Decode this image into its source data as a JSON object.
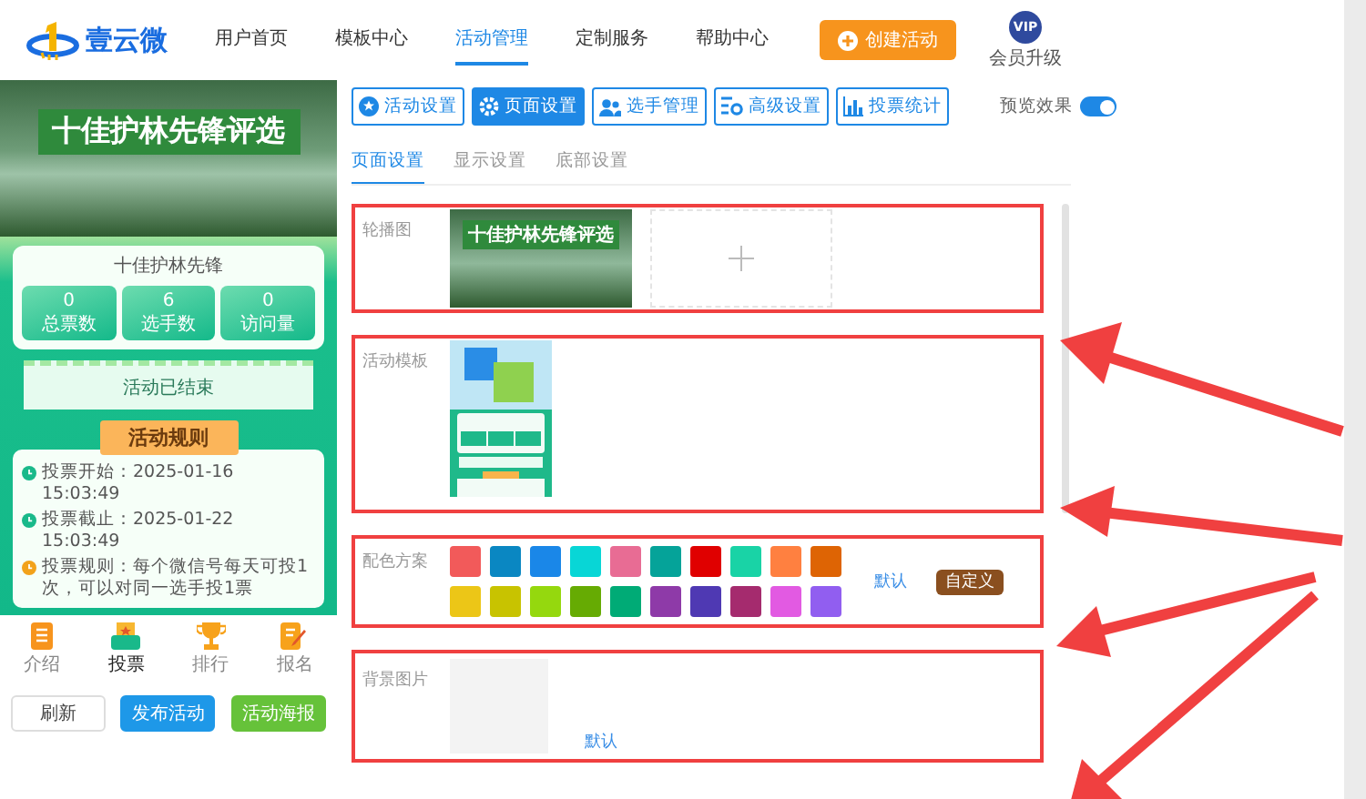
{
  "header": {
    "logo": "壹云微",
    "nav": [
      {
        "label": "用户首页",
        "selected": false
      },
      {
        "label": "模板中心",
        "selected": false
      },
      {
        "label": "活动管理",
        "selected": true
      },
      {
        "label": "定制服务",
        "selected": false
      },
      {
        "label": "帮助中心",
        "selected": false
      }
    ],
    "create_button": "创建活动",
    "vip": {
      "badge": "VIP",
      "label": "会员升级"
    }
  },
  "preview": {
    "banner_title": "十佳护林先锋评选",
    "activity_name": "十佳护林先锋",
    "stats": [
      {
        "value": "0",
        "label": "总票数"
      },
      {
        "value": "6",
        "label": "选手数"
      },
      {
        "value": "0",
        "label": "访问量"
      }
    ],
    "status": "活动已结束",
    "rules_title": "活动规则",
    "rules": [
      {
        "kind": "start",
        "label": "投票开始：",
        "text": "2025-01-16 15:03:49"
      },
      {
        "kind": "end",
        "label": "投票截止：",
        "text": "2025-01-22 15:03:49"
      },
      {
        "kind": "rule",
        "label": "投票规则：",
        "text": "每个微信号每天可投1次，可以对同一选手投1票"
      }
    ],
    "bottom_nav": [
      {
        "label": "介绍",
        "selected": false
      },
      {
        "label": "投票",
        "selected": true
      },
      {
        "label": "排行",
        "selected": false
      },
      {
        "label": "报名",
        "selected": false
      }
    ]
  },
  "actions": [
    {
      "kind": "plain",
      "label": "刷新"
    },
    {
      "kind": "primary",
      "label": "发布活动"
    },
    {
      "kind": "success",
      "label": "活动海报"
    }
  ],
  "toolbar": {
    "buttons": [
      {
        "label": "活动设置",
        "selected": false
      },
      {
        "label": "页面设置",
        "selected": true
      },
      {
        "label": "选手管理",
        "selected": false
      },
      {
        "label": "高级设置",
        "selected": false
      },
      {
        "label": "投票统计",
        "selected": false
      }
    ],
    "preview_toggle": {
      "label": "预览效果",
      "on": true
    }
  },
  "subtabs": [
    {
      "label": "页面设置",
      "selected": true
    },
    {
      "label": "显示设置",
      "selected": false
    },
    {
      "label": "底部设置",
      "selected": false
    }
  ],
  "sections": [
    {
      "kind": "carousel",
      "label": "轮播图",
      "banner_title": "十佳护林先锋评选"
    },
    {
      "kind": "template",
      "label": "活动模板"
    },
    {
      "kind": "colors",
      "label": "配色方案",
      "swatches": [
        {
          "color": "#f25a5a"
        },
        {
          "color": "#0a87c2"
        },
        {
          "color": "#1a87e8"
        },
        {
          "color": "#08d6d6"
        },
        {
          "color": "#e86c94"
        },
        {
          "color": "#05a399"
        },
        {
          "color": "#e00000"
        },
        {
          "color": "#19d3a6"
        },
        {
          "color": "#ff8040"
        },
        {
          "color": "#de6404"
        },
        {
          "color": "#ecc617"
        },
        {
          "color": "#c8c300"
        },
        {
          "color": "#95d80e"
        },
        {
          "color": "#66ab03"
        },
        {
          "color": "#00ab76"
        },
        {
          "color": "#8e3aa8"
        },
        {
          "color": "#4f39b3"
        },
        {
          "color": "#a52b6e"
        },
        {
          "color": "#e25ae2"
        },
        {
          "color": "#915ef0"
        }
      ],
      "default_link": "默认",
      "custom_button": "自定义"
    },
    {
      "kind": "background",
      "label": "背景图片",
      "default_link": "默认"
    }
  ]
}
